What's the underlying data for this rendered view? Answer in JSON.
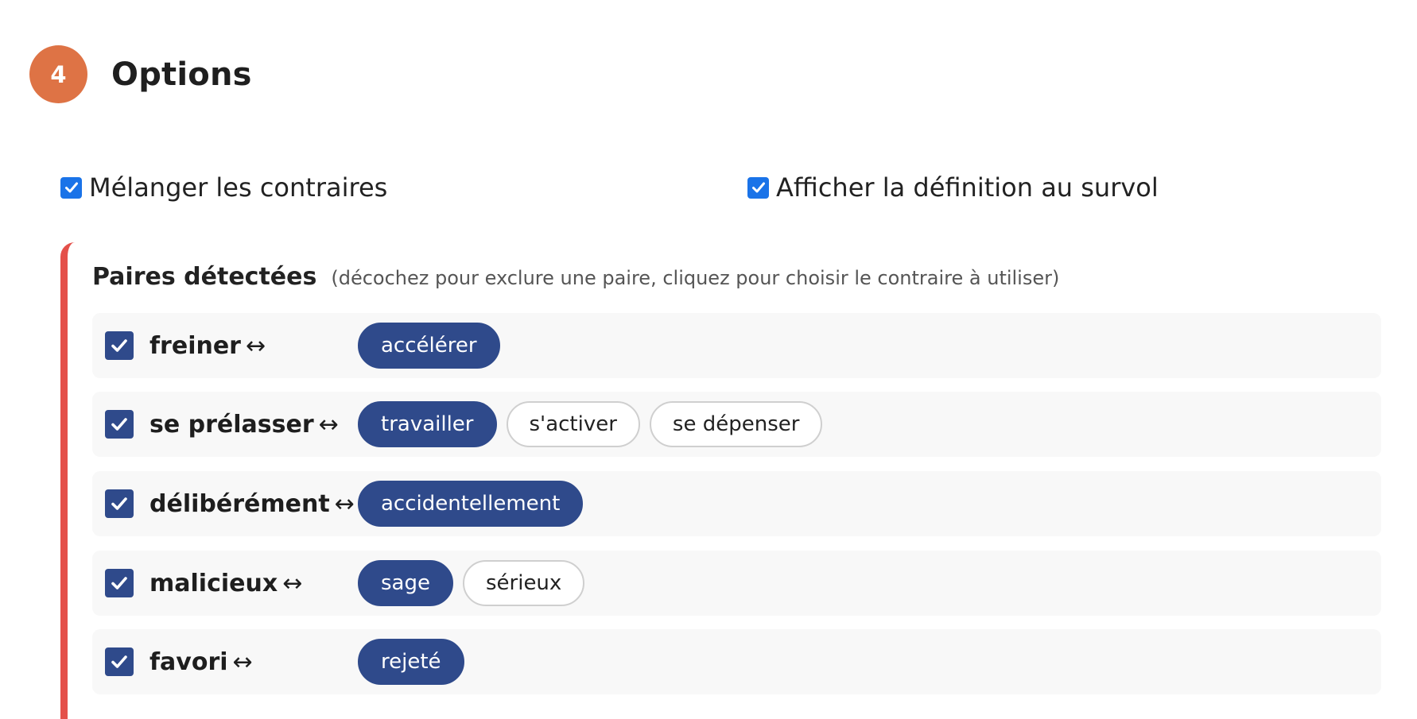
{
  "section": {
    "number": "4",
    "title": "Options"
  },
  "options": [
    {
      "label": "Mélanger les contraires",
      "checked": true
    },
    {
      "label": "Afficher la définition au survol",
      "checked": true
    }
  ],
  "pairs": {
    "title": "Paires détectées",
    "hint": "(décochez pour exclure une paire, cliquez pour choisir le contraire à utiliser)",
    "arrow": "↔",
    "rows": [
      {
        "word": "freiner",
        "checked": true,
        "selected": "accélérer",
        "alternatives": []
      },
      {
        "word": "se prélasser",
        "checked": true,
        "selected": "travailler",
        "alternatives": [
          "s'activer",
          "se dépenser"
        ]
      },
      {
        "word": "délibérément",
        "checked": true,
        "selected": "accidentellement",
        "alternatives": []
      },
      {
        "word": "malicieux",
        "checked": true,
        "selected": "sage",
        "alternatives": [
          "sérieux"
        ]
      },
      {
        "word": "favori",
        "checked": true,
        "selected": "rejeté",
        "alternatives": []
      }
    ]
  },
  "colors": {
    "badge": "#de7345",
    "accent_border": "#e4504a",
    "chip_selected": "#2f4a8b",
    "option_checkbox": "#1a73e8"
  }
}
